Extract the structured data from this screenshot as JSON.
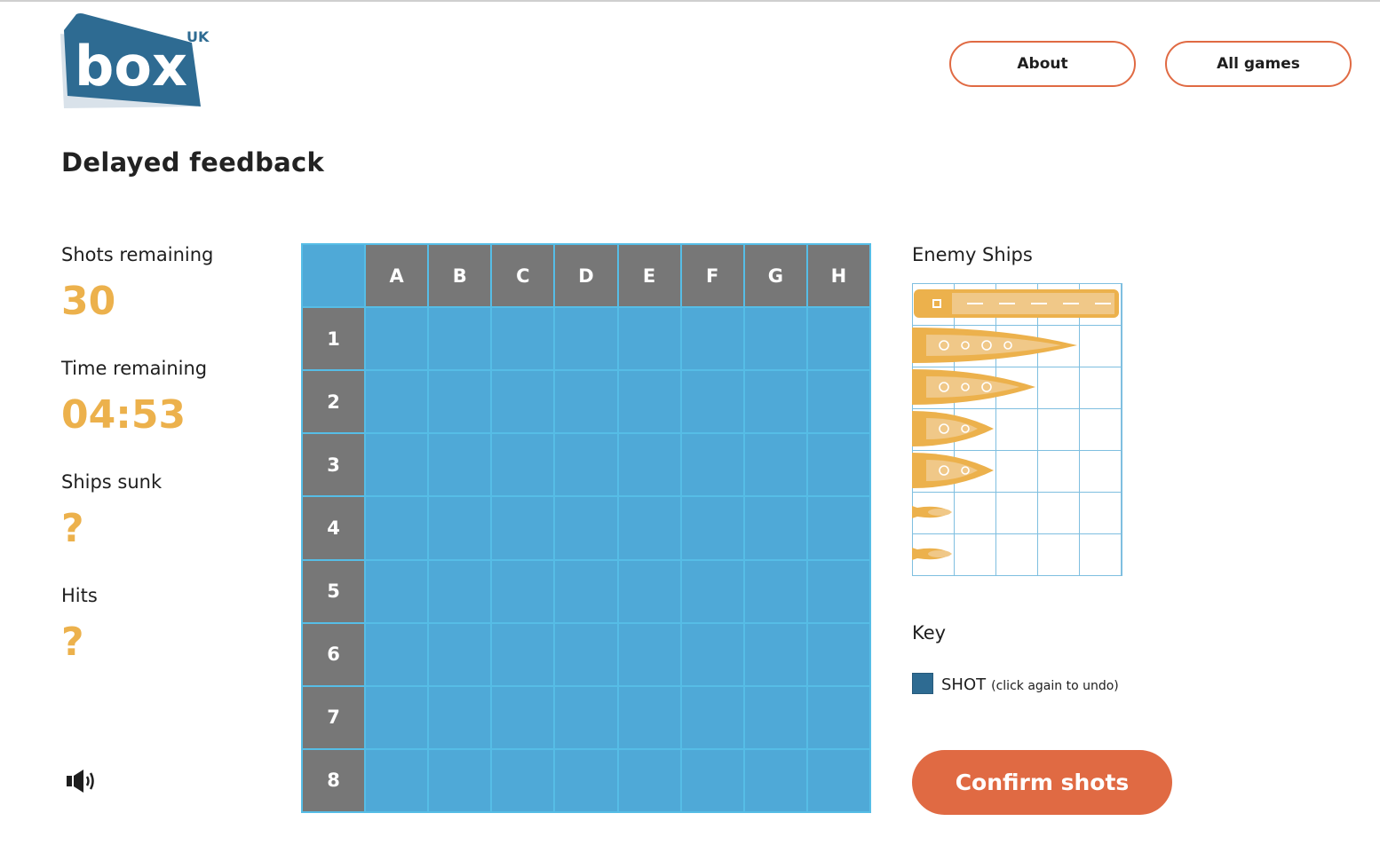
{
  "header": {
    "logo": {
      "text": "box",
      "superscript": "UK"
    },
    "nav": [
      {
        "label": "About"
      },
      {
        "label": "All games"
      }
    ]
  },
  "page_title": "Delayed feedback",
  "stats": {
    "shots_remaining": {
      "label": "Shots remaining",
      "value": "30"
    },
    "time_remaining": {
      "label": "Time remaining",
      "value": "04:53"
    },
    "ships_sunk": {
      "label": "Ships sunk",
      "value": "?"
    },
    "hits": {
      "label": "Hits",
      "value": "?"
    }
  },
  "sound_icon": "speaker-on-icon",
  "board": {
    "columns": [
      "A",
      "B",
      "C",
      "D",
      "E",
      "F",
      "G",
      "H"
    ],
    "rows": [
      "1",
      "2",
      "3",
      "4",
      "5",
      "6",
      "7",
      "8"
    ],
    "shots": []
  },
  "enemy_ships": {
    "title": "Enemy Ships",
    "ships": [
      {
        "type": "carrier",
        "length": 5
      },
      {
        "type": "battleship",
        "length": 4
      },
      {
        "type": "cruiser",
        "length": 3
      },
      {
        "type": "destroyer",
        "length": 2
      },
      {
        "type": "destroyer",
        "length": 2
      },
      {
        "type": "submarine",
        "length": 1
      },
      {
        "type": "submarine",
        "length": 1
      }
    ]
  },
  "key": {
    "title": "Key",
    "items": [
      {
        "label": "SHOT",
        "hint": "(click again to undo)",
        "color": "#2e6b92"
      }
    ]
  },
  "confirm_button": {
    "label": "Confirm shots"
  },
  "colors": {
    "accent": "#e06a43",
    "stat_value": "#ecb14c",
    "board_cell": "#4fa9d7",
    "board_header": "#777777",
    "ship": "#ecb14c",
    "brand": "#2e6b92"
  }
}
